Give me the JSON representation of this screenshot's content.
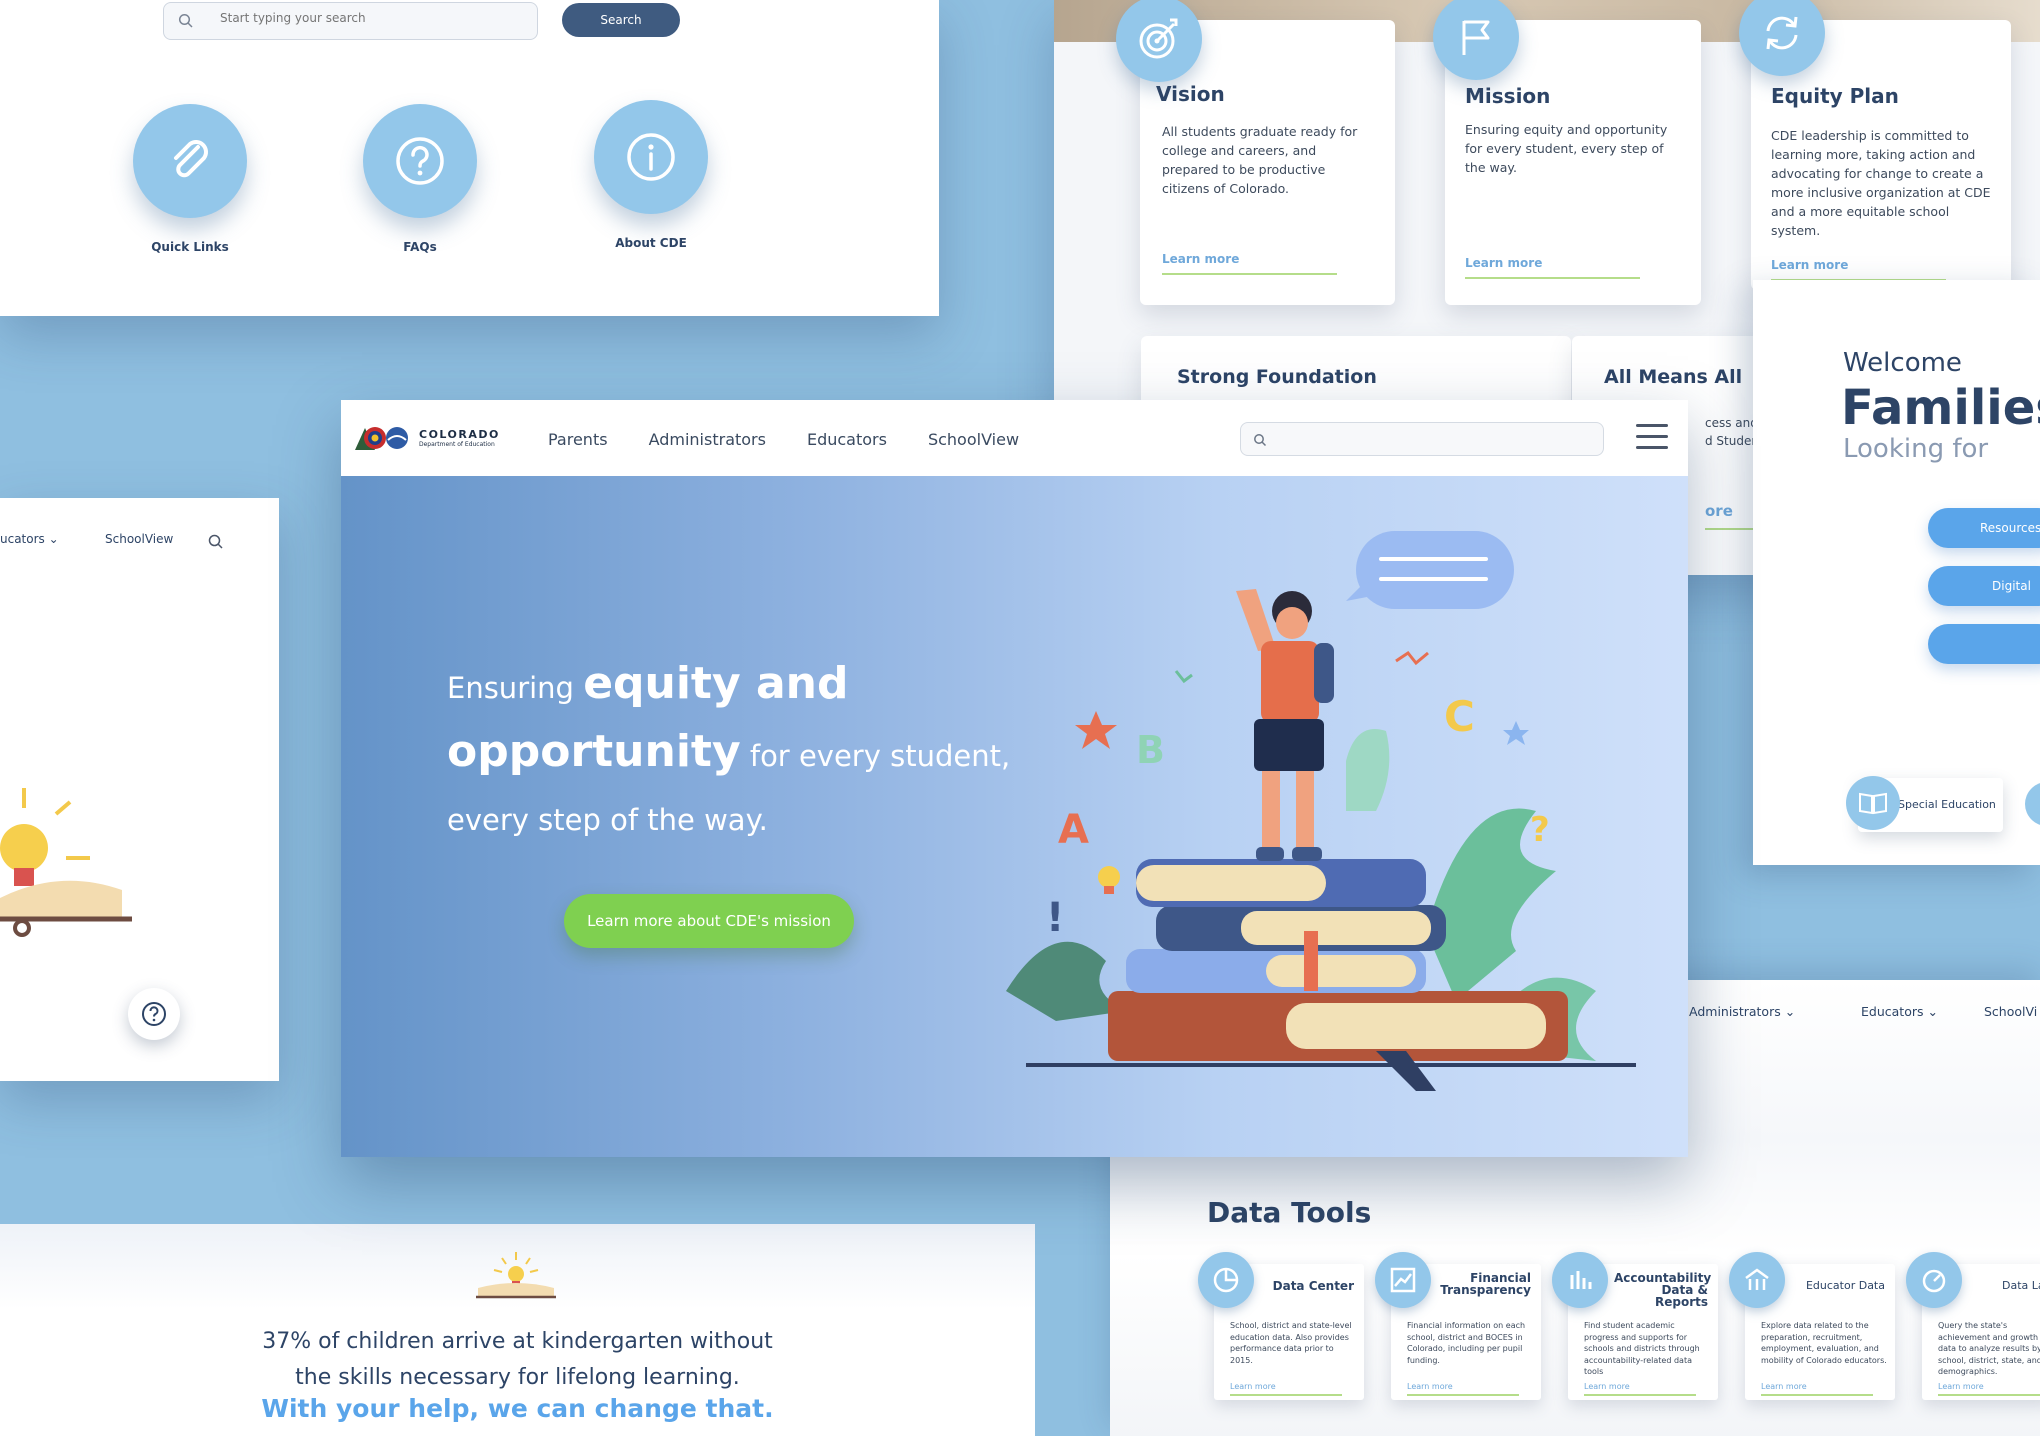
{
  "panelA": {
    "search_placeholder": "Start typing your search",
    "search_button": "Search",
    "quick_links": [
      {
        "label": "Quick Links",
        "icon": "paperclip-icon"
      },
      {
        "label": "FAQs",
        "icon": "question-icon"
      },
      {
        "label": "About CDE",
        "icon": "info-icon"
      }
    ]
  },
  "cards": [
    {
      "title": "Vision",
      "text": "All students graduate ready for college and careers, and prepared to be productive citizens of Colorado.",
      "link": "Learn more",
      "icon": "target-icon"
    },
    {
      "title": "Mission",
      "text": "Ensuring equity and opportunity for every student, every step of the way.",
      "link": "Learn more",
      "icon": "flag-icon"
    },
    {
      "title": "Equity Plan",
      "text": "CDE leadership is committed to learning more, taking action and advocating for change to create a more inclusive organization at CDE and a more equitable school system.",
      "link": "Learn more",
      "icon": "refresh-icon"
    }
  ],
  "foundation_cards": [
    {
      "title": "Strong Foundation"
    },
    {
      "title": "All Means All",
      "text1": "cess and C",
      "text2": "d Student",
      "link": "ore"
    }
  ],
  "welcome": {
    "line1": "Welcome",
    "line2": "Families",
    "line3": "Looking for",
    "pills": [
      "Resources f",
      "Digital"
    ],
    "special": "Special Education"
  },
  "left_strip": {
    "nav1": "ucators ⌄",
    "nav2": "SchoolView"
  },
  "main": {
    "logo_title": "COLORADO",
    "logo_sub": "Department of Education",
    "nav": [
      "Parents",
      "Administrators",
      "Educators",
      "SchoolView"
    ],
    "hero_lead": "Ensuring",
    "hero_bold1": "equity and",
    "hero_bold2": "opportunity",
    "hero_rest": "for every student,",
    "hero_line3": "every step of the way.",
    "cta": "Learn more about CDE's mission",
    "illus_letters": [
      "B",
      "C",
      "A",
      "?",
      "!"
    ]
  },
  "stats": {
    "line1": "37% of children arrive at kindergarten without the skills necessary for lifelong learning.",
    "line2": "With your help, we can change that."
  },
  "bottom_nav": [
    "Administrators ⌄",
    "Educators ⌄",
    "SchoolVi"
  ],
  "data_tools": {
    "heading": "Data Tools",
    "tools": [
      {
        "title": "Data Center",
        "desc": "School, district and state-level education data. Also provides performance data prior to 2015.",
        "link": "Learn more",
        "icon": "pie-chart-icon"
      },
      {
        "title": "Financial Transparency",
        "desc": "Financial information on each school, district and BOCES in Colorado, including per pupil funding.",
        "link": "Learn more",
        "icon": "trend-chart-icon"
      },
      {
        "title": "Accountability Data & Reports",
        "desc": "Find student academic progress and supports for schools and districts through accountability-related data tools",
        "link": "Learn more",
        "icon": "bar-chart-icon"
      },
      {
        "title": "Educator Data",
        "desc": "Explore data related to the preparation, recruitment, employment, evaluation, and mobility of Colorado educators.",
        "link": "Learn more",
        "icon": "school-icon"
      },
      {
        "title": "Data Lal",
        "desc": "Query the state's achievement and growth data to analyze results by school, district, state, and demographics.",
        "link": "Learn more",
        "icon": "gauge-icon"
      }
    ]
  }
}
